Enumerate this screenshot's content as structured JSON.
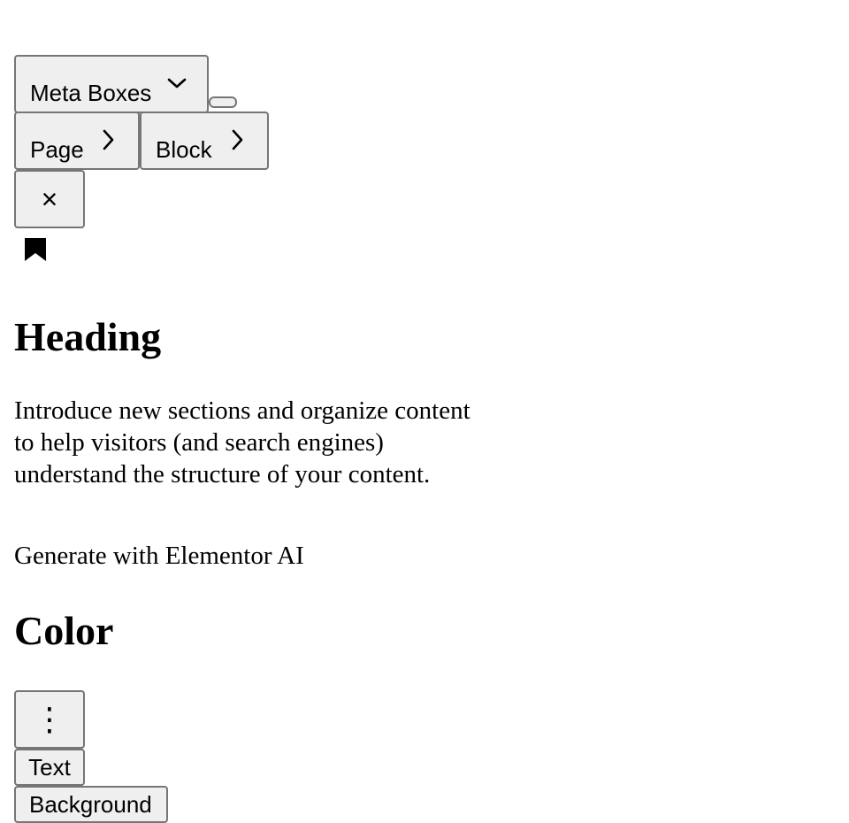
{
  "toolbar": {
    "meta_boxes_label": "Meta Boxes",
    "page_label": "Page",
    "block_label": "Block",
    "close_symbol": "×"
  },
  "block_card": {
    "title": "Heading",
    "description": "Introduce new sections and organize content to help visitors (and search engines) understand the structure of your content.",
    "ai_link": "Generate with Elementor AI"
  },
  "color_panel": {
    "title": "Color",
    "options_symbol": "⋮",
    "tabs": [
      "Text",
      "Background"
    ]
  },
  "icons": {
    "meta_boxes": "chevron-down-icon",
    "page": "chevron-right-icon",
    "block": "chevron-right-icon",
    "close": "close-icon",
    "block_type": "bookmark-icon",
    "options": "more-vertical-icon"
  }
}
